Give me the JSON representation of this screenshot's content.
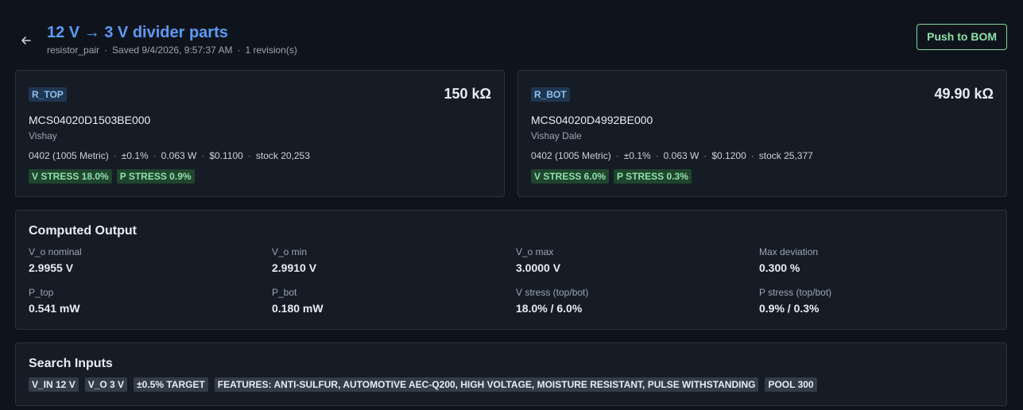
{
  "header": {
    "title": "12 V → 3 V divider parts",
    "type": "resistor_pair",
    "saved": "Saved 9/4/2026, 9:57:37 AM",
    "revisions": "1 revision(s)",
    "push_label": "Push to BOM",
    "back_icon": "arrow-left-icon"
  },
  "parts": [
    {
      "ref": "R_TOP",
      "value": "150 kΩ",
      "mpn": "MCS04020D1503BE000",
      "manufacturer": "Vishay",
      "package": "0402 (1005 Metric)",
      "tolerance": "±0.1%",
      "power": "0.063 W",
      "price": "$0.1100",
      "stock": "stock 20,253",
      "v_stress": "V STRESS 18.0%",
      "p_stress": "P STRESS 0.9%"
    },
    {
      "ref": "R_BOT",
      "value": "49.90 kΩ",
      "mpn": "MCS04020D4992BE000",
      "manufacturer": "Vishay Dale",
      "package": "0402 (1005 Metric)",
      "tolerance": "±0.1%",
      "power": "0.063 W",
      "price": "$0.1200",
      "stock": "stock 25,377",
      "v_stress": "V STRESS 6.0%",
      "p_stress": "P STRESS 0.3%"
    }
  ],
  "computed": {
    "title": "Computed Output",
    "metrics": [
      {
        "label": "V_o nominal",
        "value": "2.9955 V"
      },
      {
        "label": "V_o min",
        "value": "2.9910 V"
      },
      {
        "label": "V_o max",
        "value": "3.0000 V"
      },
      {
        "label": "Max deviation",
        "value": "0.300 %"
      },
      {
        "label": "P_top",
        "value": "0.541 mW"
      },
      {
        "label": "P_bot",
        "value": "0.180 mW"
      },
      {
        "label": "V stress (top/bot)",
        "value": "18.0% / 6.0%"
      },
      {
        "label": "P stress (top/bot)",
        "value": "0.9% / 0.3%"
      }
    ]
  },
  "search": {
    "title": "Search Inputs",
    "chips": [
      "V_IN 12 V",
      "V_O 3 V",
      "±0.5% TARGET",
      "FEATURES: ANTI-SULFUR, AUTOMOTIVE AEC-Q200, HIGH VOLTAGE, MOISTURE RESISTANT, PULSE WITHSTANDING",
      "POOL 300"
    ]
  },
  "colors": {
    "background": "#0f141c",
    "panel": "#161c26",
    "title_accent": "#5b9bf5",
    "push_accent": "#8ee0a8",
    "ref_tag": "#1f3650",
    "stress_badge": "#20452f"
  }
}
